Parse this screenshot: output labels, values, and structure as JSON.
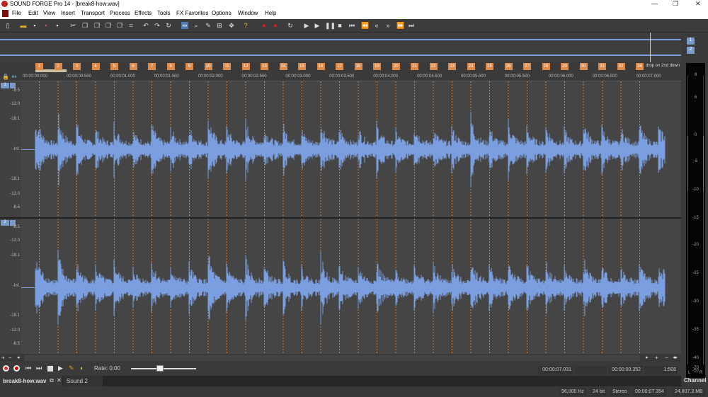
{
  "window": {
    "title": "SOUND FORGE Pro 14 - [break8-how.wav]",
    "controls": [
      "—",
      "❐",
      "✕"
    ]
  },
  "menu": [
    "File",
    "Edit",
    "View",
    "Insert",
    "Transport",
    "Process",
    "Effects",
    "Tools",
    "FX Favorites",
    "Options",
    "Window",
    "Help"
  ],
  "toolbar": [
    "new",
    "open",
    "save",
    "save-as",
    "save-all",
    "cut",
    "copy",
    "paste",
    "paste-mix",
    "paste-crossfade",
    "crop",
    "undo",
    "redo",
    "repeat",
    "edit-tool",
    "magnify-tool",
    "pencil-tool",
    "envelope-tool",
    "event-tool",
    "help",
    "record",
    "record-stop",
    "loop",
    "play-all",
    "play",
    "pause",
    "stop",
    "go-start",
    "rewind",
    "rewind-fast",
    "forward",
    "forward-fast",
    "go-end"
  ],
  "markers": [
    "1",
    "2",
    "3",
    "4",
    "5",
    "6",
    "7",
    "8",
    "9",
    "10",
    "11",
    "12",
    "13",
    "14",
    "15",
    "16",
    "17",
    "18",
    "19",
    "20",
    "21",
    "22",
    "23",
    "24",
    "25",
    "26",
    "27",
    "28",
    "29",
    "30",
    "31",
    "32",
    "34"
  ],
  "marker_note": "drop on 2nd down",
  "ruler": [
    "00:00:00.000",
    "00:00:00.500",
    "00:00:01.000",
    "00:00:01.500",
    "00:00:02.000",
    "00:00:02.500",
    "00:00:03.000",
    "00:00:03.500",
    "00:00:04.000",
    "00:00:04.500",
    "00:00:05.000",
    "00:00:05.500",
    "00:00:06.000",
    "00:00:06.500",
    "00:00:07.000"
  ],
  "db_labels": [
    "-8.5",
    "-12.0",
    "-18.1",
    "-Inf.",
    "-18.1",
    "-12.0",
    "-8.5"
  ],
  "channels": [
    "1",
    "2"
  ],
  "meter": {
    "labels": [
      "9",
      "6",
      "0",
      "-5",
      "-10",
      "-15",
      "-20",
      "-25",
      "-30",
      "-35",
      "-40",
      "-50",
      "-70"
    ],
    "channels_l": "L",
    "channels_r": "R",
    "title": "Channel",
    "buttons": [
      "1",
      "2"
    ]
  },
  "transport": {
    "rate": "Rate: 0.00",
    "rate_value": 0.5,
    "cursor": "00:00:07.031",
    "selection": "",
    "length": "00:00:00.352",
    "zoom": "1:508"
  },
  "tabs": [
    "break8-how.wav",
    "Sound 2"
  ],
  "status": {
    "rate": "96,000 Hz",
    "bits": "24 bit",
    "channels": "Stereo",
    "duration": "00:00:07.354",
    "space": "24,807.3 MB"
  },
  "colors": {
    "wave": "#7a9ee0",
    "marker": "#e08a4a",
    "bg": "#414141"
  }
}
